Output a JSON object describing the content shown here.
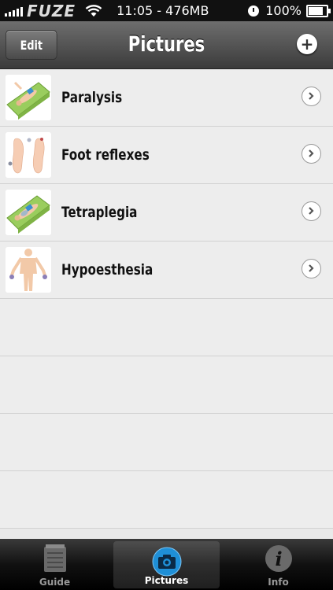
{
  "status_bar": {
    "carrier": "FUZE",
    "time_memory": "11:05 - 476MB",
    "battery_percent": "100%",
    "battery_level": 1.0,
    "icons": [
      "signal-icon",
      "wifi-icon",
      "alarm-icon",
      "battery-icon"
    ]
  },
  "navbar": {
    "edit_label": "Edit",
    "title": "Pictures",
    "add_icon": "plus-icon"
  },
  "list": {
    "items": [
      {
        "label": "Paralysis",
        "thumb": "lying-figure-thumbnail",
        "accessory": "chevron-right-icon"
      },
      {
        "label": "Foot reflexes",
        "thumb": "feet-thumbnail",
        "accessory": "chevron-right-icon"
      },
      {
        "label": "Tetraplegia",
        "thumb": "lying-figure-thumbnail",
        "accessory": "chevron-right-icon"
      },
      {
        "label": "Hypoesthesia",
        "thumb": "standing-figure-thumbnail",
        "accessory": "chevron-right-icon"
      }
    ]
  },
  "tabbar": {
    "tabs": [
      {
        "label": "Guide",
        "icon": "notepad-icon",
        "active": false
      },
      {
        "label": "Pictures",
        "icon": "camera-icon",
        "active": true
      },
      {
        "label": "Info",
        "icon": "info-icon",
        "active": false
      }
    ]
  },
  "colors": {
    "navbar_top": "#6e6e6e",
    "navbar_bottom": "#3b3b3b",
    "list_background": "#ededed",
    "camera_blue": "#1f8fd6"
  }
}
